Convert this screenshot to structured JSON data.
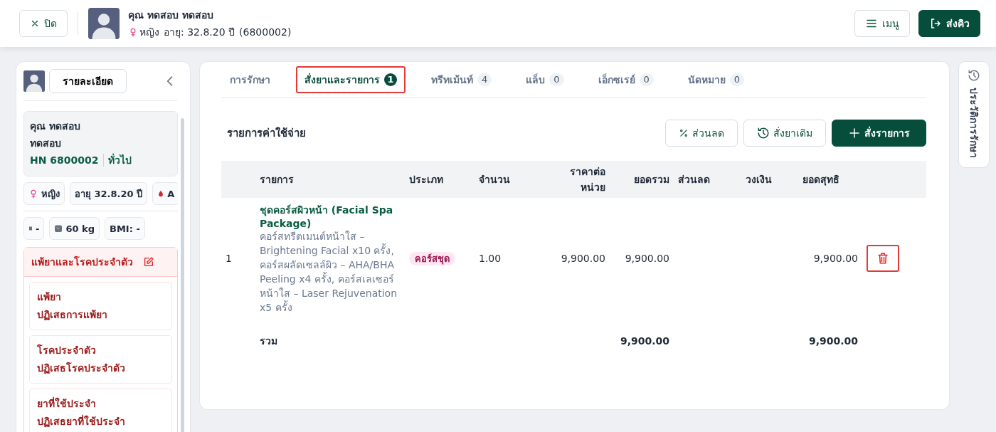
{
  "header": {
    "close_label": "ปิด",
    "patient_name": "คุณ ทดสอบ ทดสอบ",
    "gender": "หญิง",
    "age": "อายุ: 32.8.20 ปี",
    "patient_id": "(6800002)",
    "menu_label": "เมนู",
    "send_label": "ส่งคิว"
  },
  "sidebar": {
    "details_button": "รายละเอียด",
    "name_lines": [
      "คุณ ทดสอบ",
      "ทดสอบ"
    ],
    "hn": "HN 6800002",
    "patient_type": "ทั่วไป",
    "pills": [
      {
        "kind": "gender",
        "text": "หญิง"
      },
      {
        "kind": "plain",
        "text": "อายุ 32.8.20 ปี"
      },
      {
        "kind": "blood",
        "text": "A"
      }
    ],
    "measures": [
      {
        "kind": "height",
        "text": "-"
      },
      {
        "kind": "weight",
        "text": "60 kg"
      },
      {
        "kind": "plain",
        "text": "BMI: -"
      }
    ],
    "allergy_title": "แพ้ยาและโรคประจำตัว",
    "allergy_cards": [
      {
        "title": "แพ้ยา",
        "value": "ปฏิเสธการแพ้ยา"
      },
      {
        "title": "โรคประจำตัว",
        "value": "ปฏิเสธโรคประจำตัว"
      },
      {
        "title": "ยาที่ใช้ประจำ",
        "value": "ปฏิเสธยาที่ใช้ประจำ"
      }
    ]
  },
  "tabs": [
    {
      "label": "การรักษา",
      "selected": false,
      "highlighted": false
    },
    {
      "label": "สั่งยาและรายการ",
      "count": "1",
      "selected": true,
      "highlighted": true
    },
    {
      "label": "ทรีทเม้นท์",
      "count": "4",
      "selected": false,
      "highlighted": false
    },
    {
      "label": "แล็บ",
      "count": "0",
      "selected": false,
      "highlighted": false
    },
    {
      "label": "เอ็กซเรย์",
      "count": "0",
      "selected": false,
      "highlighted": false
    },
    {
      "label": "นัดหมาย",
      "count": "0",
      "selected": false,
      "highlighted": false
    }
  ],
  "section_title": "รายการค่าใช้จ่าย",
  "actions": [
    {
      "kind": "discount",
      "label": "ส่วนลด"
    },
    {
      "kind": "history",
      "label": "สั่งยาเดิม"
    },
    {
      "kind": "add",
      "label": "สั่งรายการ"
    }
  ],
  "table": {
    "columns": [
      "รายการ",
      "ประเภท",
      "จำนวน",
      "ราคาต่อ หน่วย",
      "ยอดรวม",
      "ส่วนลด",
      "วงเงิน",
      "ยอดสุทธิ"
    ],
    "rows": [
      {
        "index": "1",
        "name": "ชุดคอร์สผิวหน้า (Facial Spa Package)",
        "description": "คอร์สทรีตเมนต์หน้าใส – Brightening Facial x10 ครั้ง, คอร์สผลัดเซลล์ผิว – AHA/BHA Peeling x4 ครั้ง, คอร์สเลเซอร์หน้าใส – Laser Rejuvenation x5 ครั้ง",
        "type": "คอร์สชุด",
        "quantity": "1.00",
        "unit_price": "9,900.00",
        "total": "9,900.00",
        "net": "9,900.00",
        "delete_highlighted": true
      }
    ],
    "total_row": {
      "label": "รวม",
      "total": "9,900.00",
      "net": "9,900.00"
    }
  },
  "history_tab": {
    "label": "ประวัติการรักษา"
  }
}
